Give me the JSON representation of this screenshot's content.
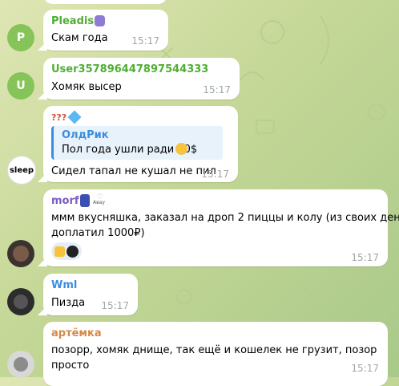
{
  "messages": [
    {
      "id": "m1",
      "sender": "Pleadis",
      "avatar_letter": "P",
      "avatar_color": "#86c45a",
      "name_color": "#4fae33",
      "text": "Скам года",
      "time": "15:17"
    },
    {
      "id": "m2",
      "sender": "User357896447897544333",
      "avatar_letter": "U",
      "avatar_color": "#86c45a",
      "name_color": "#4fae33",
      "text": "Хомяк высер",
      "time": "15:17"
    },
    {
      "id": "m3",
      "sender": "???",
      "name_color": "#d9503a",
      "reply_name": "ОлдРик",
      "reply_text": "Пол года ушли ради 20$",
      "text": "Сидел тапал не кушал не пил",
      "time": "15:17",
      "avatar_text": "sleep"
    },
    {
      "id": "m4",
      "sender": "morf",
      "name_color": "#7c5cbf",
      "text_line1": "ммм вкусняшка, заказал на дроп 2 пиццы и колу (из своих денег",
      "text_line2": "доплатил 1000₽)",
      "time": "15:17",
      "badge_text": "Авау"
    },
    {
      "id": "m5",
      "sender": "Wml",
      "name_color": "#3b8de0",
      "text": "Пизда",
      "time": "15:17"
    },
    {
      "id": "m6",
      "sender": "артёмка",
      "name_color": "#d5884a",
      "text_line1": "позорр, хомяк днище, так ещё и кошелек не грузит, позор",
      "text_line2": "просто",
      "time": "15:17"
    }
  ],
  "colors": {
    "bubble": "#ffffff",
    "time": "#a0a8a0",
    "reply_bar": "#3b8de0",
    "reaction_bg": "#e5eef8"
  }
}
